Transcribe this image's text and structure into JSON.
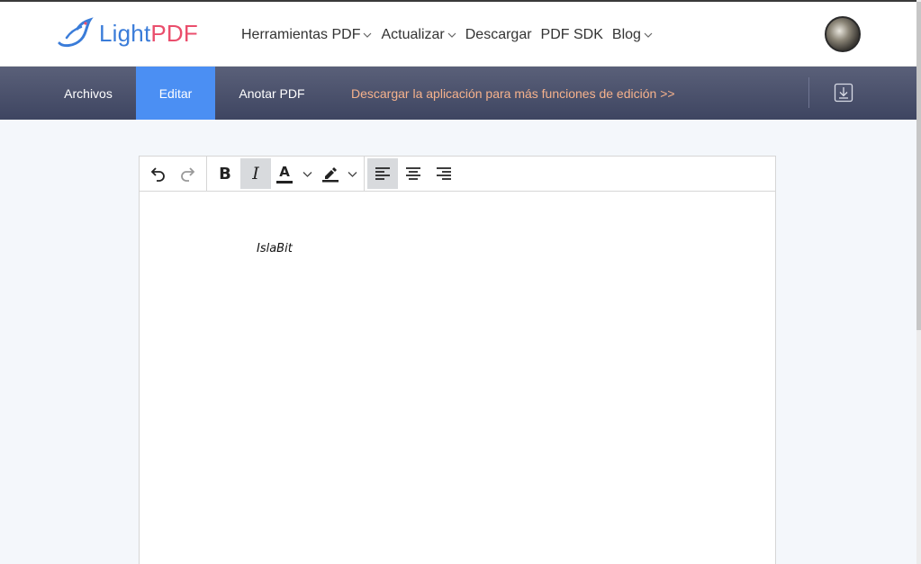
{
  "header": {
    "logo_light": "Light",
    "logo_pdf": "PDF",
    "nav": [
      {
        "label": "Herramientas PDF",
        "has_menu": true
      },
      {
        "label": "Actualizar",
        "has_menu": true
      },
      {
        "label": "Descargar",
        "has_menu": false
      },
      {
        "label": "PDF SDK",
        "has_menu": false
      },
      {
        "label": "Blog",
        "has_menu": true
      }
    ]
  },
  "toolbar": {
    "tabs": [
      {
        "label": "Archivos",
        "active": false
      },
      {
        "label": "Editar",
        "active": true
      },
      {
        "label": "Anotar PDF",
        "active": false
      }
    ],
    "promo": "Descargar la aplicación para más funciones de edición >>"
  },
  "editor": {
    "bold_label": "B",
    "italic_label": "I",
    "font_color_label": "A",
    "active_alignment": "left",
    "italic_active": true,
    "content": "IslaBit"
  },
  "colors": {
    "accent": "#4b8ff3",
    "toolbar_band": "#474d68",
    "promo": "#f6b28c",
    "logo_blue": "#3a7cd9",
    "logo_pink": "#ea4e6c"
  }
}
